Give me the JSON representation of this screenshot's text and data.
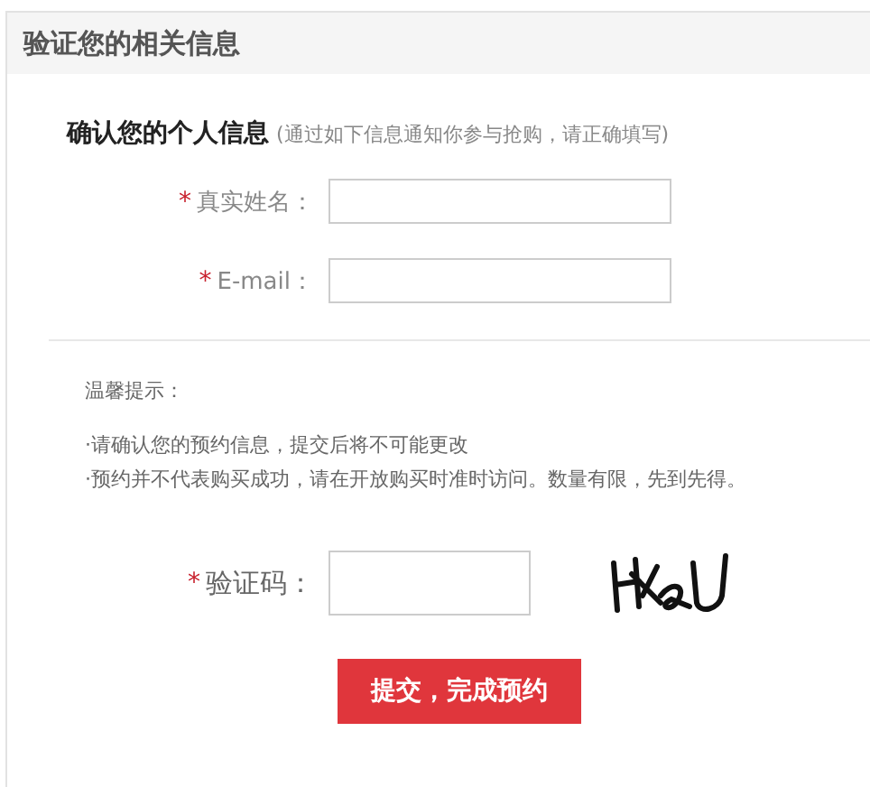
{
  "panel": {
    "title": "验证您的相关信息"
  },
  "section": {
    "heading": "确认您的个人信息",
    "note": "(通过如下信息通知你参与抢购，请正确填写)"
  },
  "fields": [
    {
      "marker": "*",
      "label": "真实姓名："
    },
    {
      "marker": "*",
      "label": "E-mail："
    }
  ],
  "tips": {
    "title": "温馨提示：",
    "lines": [
      "·请确认您的预约信息，提交后将不可能更改",
      "·预约并不代表购买成功，请在开放购买时准时访问。数量有限，先到先得。"
    ]
  },
  "captcha": {
    "marker": "*",
    "label": "验证码："
  },
  "submit_button": "提交，完成预约"
}
